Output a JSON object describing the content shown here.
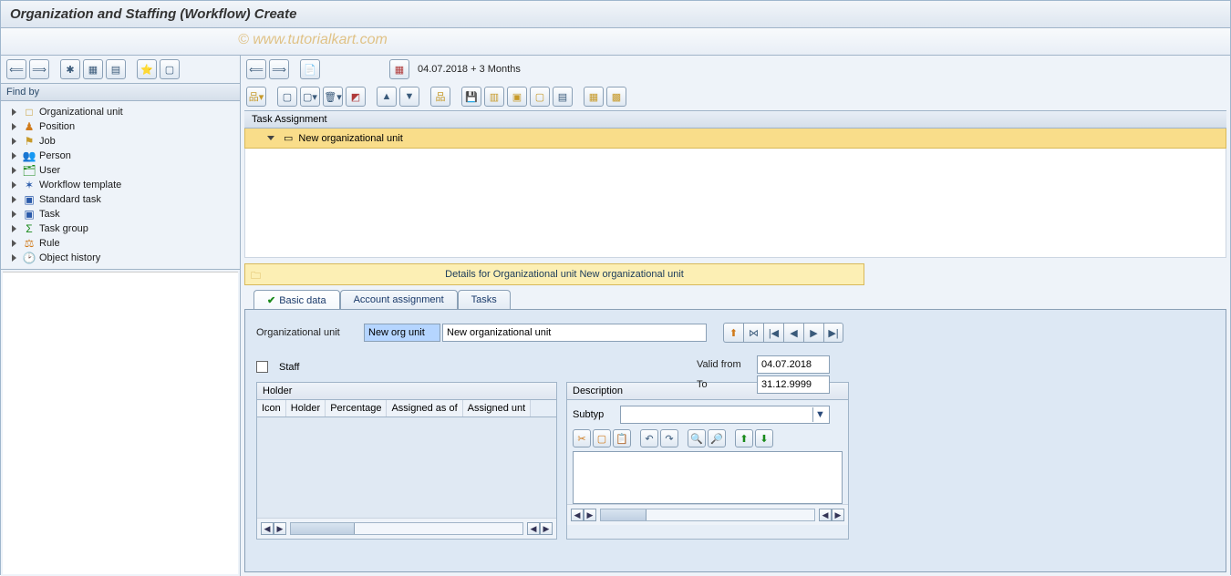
{
  "title": "Organization and Staffing (Workflow) Create",
  "watermark": "© www.tutorialkart.com",
  "left": {
    "find_by_label": "Find by",
    "tree": [
      {
        "label": "Organizational unit",
        "icon": "□",
        "cls": "ic-yellow"
      },
      {
        "label": "Position",
        "icon": "♟",
        "cls": "ic-orange"
      },
      {
        "label": "Job",
        "icon": "⚑",
        "cls": "ic-yellow"
      },
      {
        "label": "Person",
        "icon": "👥",
        "cls": "ic-orange"
      },
      {
        "label": "User",
        "icon": "🗂",
        "cls": "ic-green"
      },
      {
        "label": "Workflow template",
        "icon": "✶",
        "cls": "ic-blue"
      },
      {
        "label": "Standard task",
        "icon": "▣",
        "cls": "ic-blue"
      },
      {
        "label": "Task",
        "icon": "▣",
        "cls": "ic-blue"
      },
      {
        "label": "Task group",
        "icon": "Σ",
        "cls": "ic-green"
      },
      {
        "label": "Rule",
        "icon": "⚖",
        "cls": "ic-orange"
      },
      {
        "label": "Object history",
        "icon": "🕑",
        "cls": "ic-green"
      }
    ]
  },
  "right": {
    "date_text": "04.07.2018  + 3 Months",
    "task_header": "Task Assignment",
    "task_item": "New organizational unit",
    "details_header": "Details for Organizational unit New organizational unit",
    "tabs": {
      "basic": "Basic data",
      "account": "Account assignment",
      "tasks": "Tasks"
    },
    "org_label": "Organizational unit",
    "org_short": "New org unit",
    "org_long": "New organizational unit",
    "valid_from_label": "Valid from",
    "valid_from": "04.07.2018",
    "valid_to_label": "To",
    "valid_to": "31.12.9999",
    "staff_label": "Staff",
    "holder": {
      "title": "Holder",
      "cols": [
        "Icon",
        "Holder",
        "Percentage",
        "Assigned as of",
        "Assigned unt"
      ]
    },
    "desc": {
      "title": "Description",
      "subtyp_label": "Subtyp"
    }
  }
}
